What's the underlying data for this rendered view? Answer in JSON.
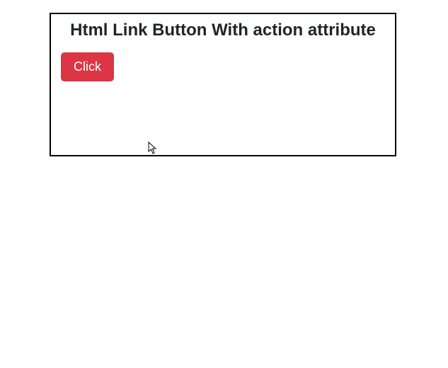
{
  "heading": "Html Link Button With action attribute",
  "button": {
    "label": "Click",
    "bg_color": "#dc3545"
  }
}
